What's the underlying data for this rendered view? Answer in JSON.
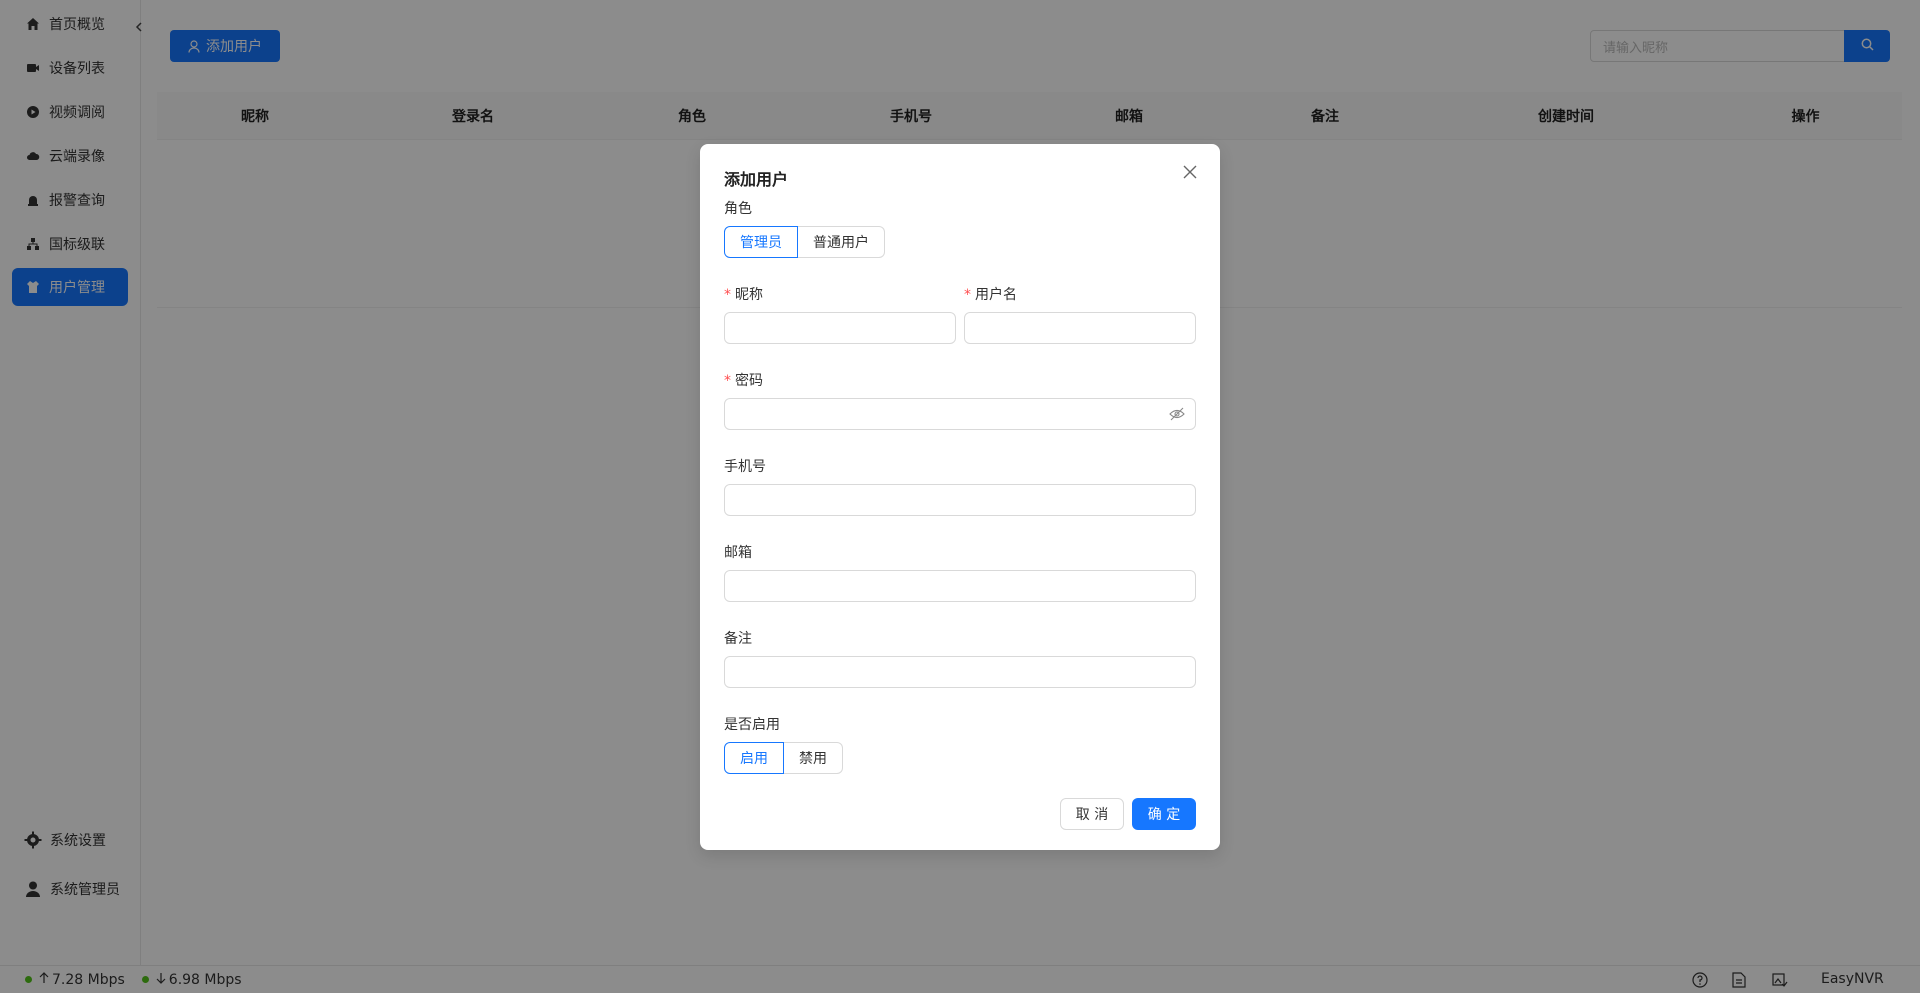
{
  "sidebar": {
    "items": [
      {
        "label": "首页概览",
        "icon": "home-icon"
      },
      {
        "label": "设备列表",
        "icon": "camera-icon"
      },
      {
        "label": "视频调阅",
        "icon": "play-icon"
      },
      {
        "label": "云端录像",
        "icon": "cloud-icon"
      },
      {
        "label": "报警查询",
        "icon": "alarm-icon"
      },
      {
        "label": "国标级联",
        "icon": "cascade-icon"
      },
      {
        "label": "用户管理",
        "icon": "shirt-icon",
        "active": true
      }
    ],
    "settings_label": "系统设置",
    "admin_label": "系统管理员"
  },
  "toolbar": {
    "add_user_label": "添加用户",
    "search_placeholder": "请输入昵称"
  },
  "table": {
    "columns": [
      "昵称",
      "登录名",
      "角色",
      "手机号",
      "邮箱",
      "备注",
      "创建时间",
      "操作"
    ]
  },
  "status": {
    "upload": "7.28 Mbps",
    "download": "6.98 Mbps",
    "brand": "EasyNVR"
  },
  "modal": {
    "title": "添加用户",
    "role_label": "角色",
    "role_options": [
      "管理员",
      "普通用户"
    ],
    "role_selected": "管理员",
    "nickname_label": "昵称",
    "username_label": "用户名",
    "password_label": "密码",
    "phone_label": "手机号",
    "email_label": "邮箱",
    "remark_label": "备注",
    "enabled_label": "是否启用",
    "enabled_options": [
      "启用",
      "禁用"
    ],
    "enabled_selected": "启用",
    "cancel_label": "取 消",
    "confirm_label": "确 定"
  },
  "colors": {
    "primary": "#1677ff",
    "required": "#ff4d4f",
    "online": "#52c41a"
  }
}
